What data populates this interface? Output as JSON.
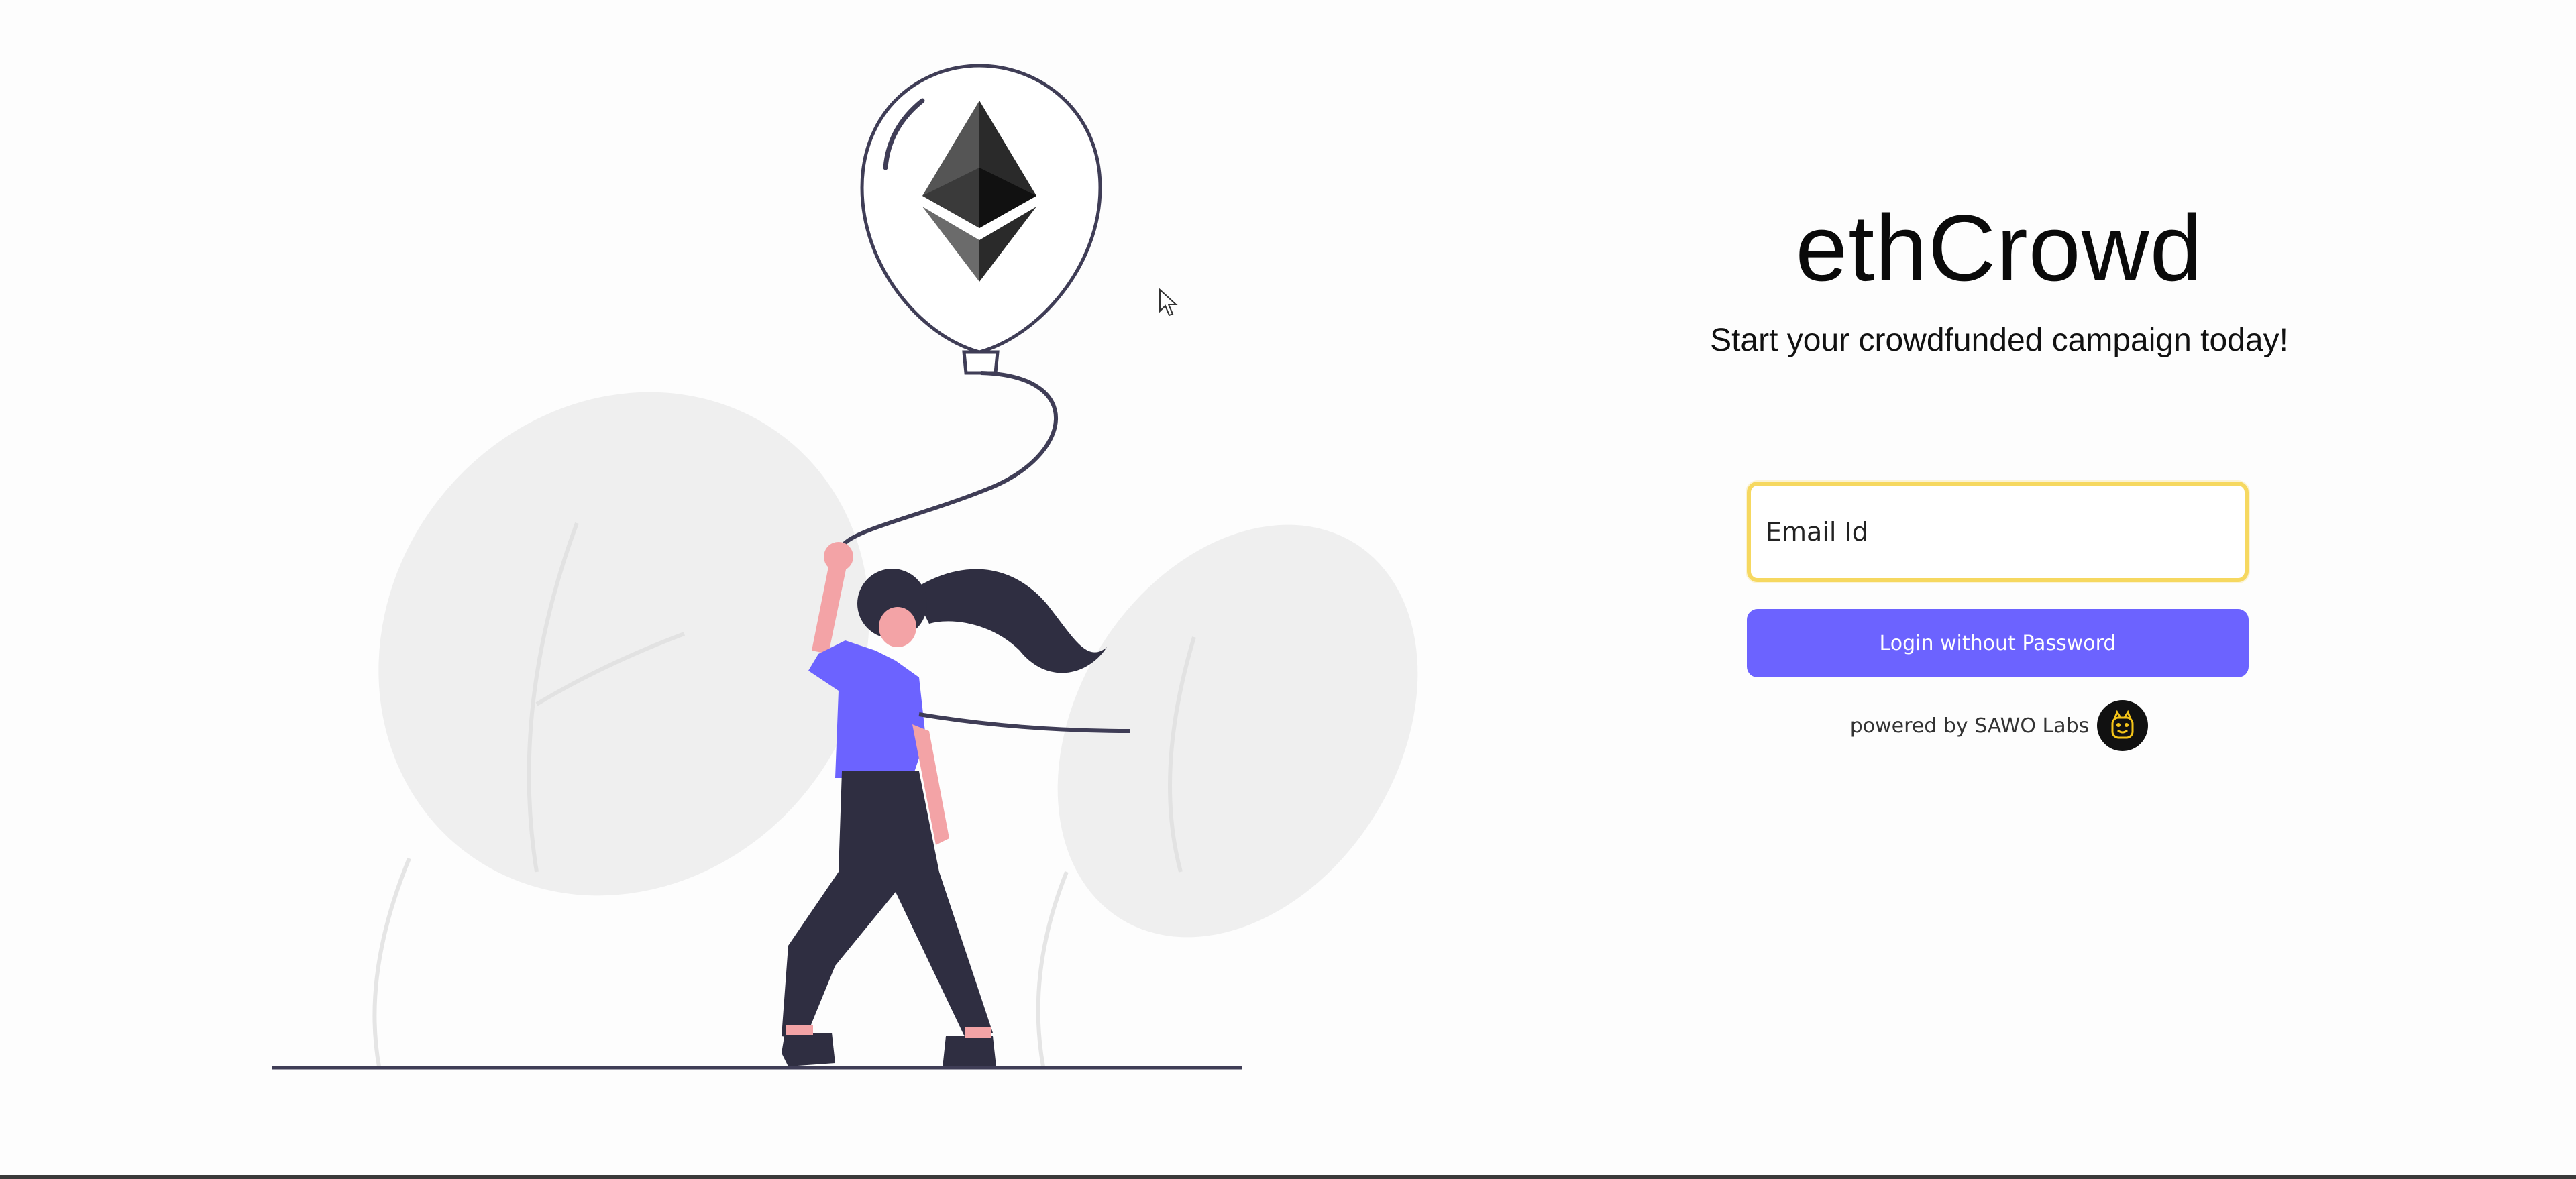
{
  "app": {
    "title": "ethCrowd",
    "tagline": "Start your crowdfunded campaign today!"
  },
  "login_form": {
    "email_placeholder": "Email Id",
    "email_value": "",
    "login_button_label": "Login without Password",
    "powered_by_label": "powered by SAWO Labs"
  },
  "icons": {
    "balloon_logo": "ethereum-icon",
    "brand_logo": "sawo-labs-logo-icon",
    "cursor": "mouse-pointer-icon"
  },
  "colors": {
    "accent": "#6c63ff",
    "input_focus_border": "#f6d860",
    "title_text": "#0a0a0a",
    "sawo_logo_bg": "#111111",
    "sawo_logo_fg": "#f5c518"
  }
}
